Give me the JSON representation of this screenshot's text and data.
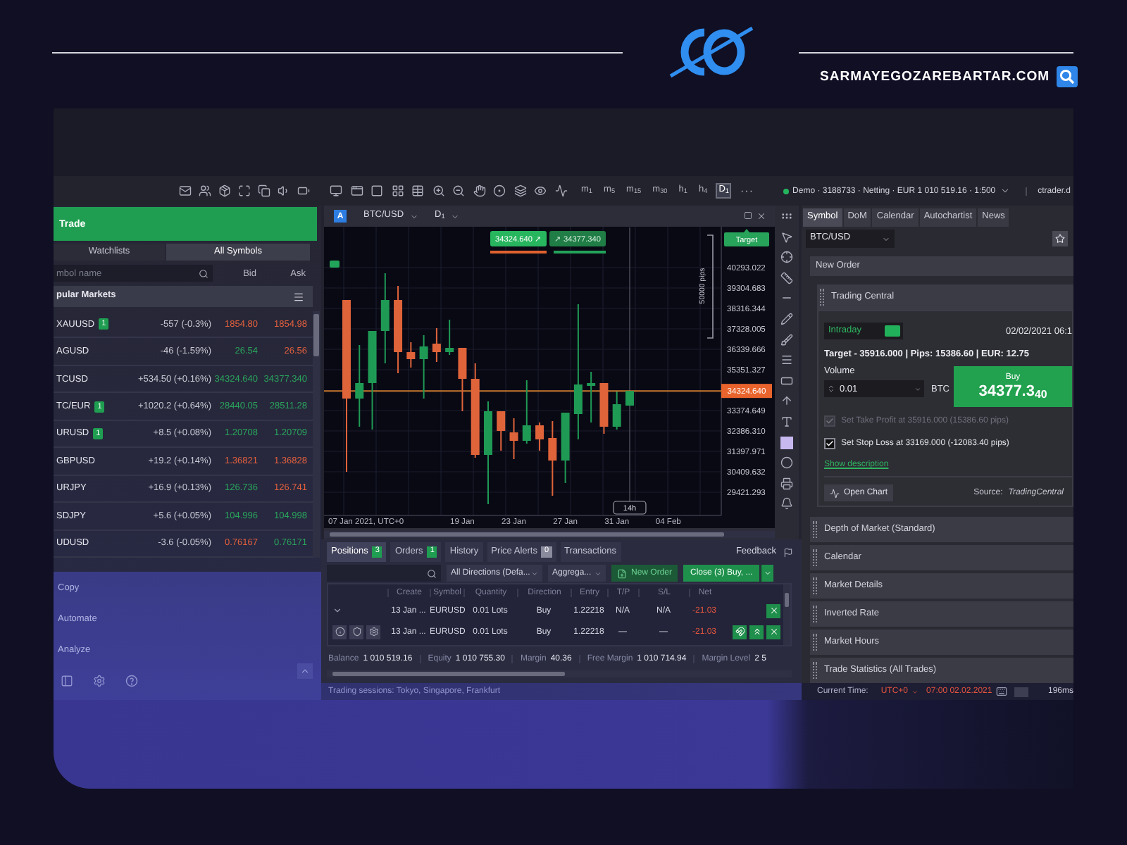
{
  "header": {
    "site_name": "SARMAYEGOZAREBARTAR.COM"
  },
  "toolbar": {
    "timeframes": [
      {
        "label": "m$_{1}$",
        "selected": false
      },
      {
        "label": "m$_{5}$",
        "selected": false
      },
      {
        "label": "m$_{15}$",
        "selected": false
      },
      {
        "label": "m$_{30}$",
        "selected": false
      },
      {
        "label": "h$_{1}$",
        "selected": false
      },
      {
        "label": "h$_{4}$",
        "selected": false
      },
      {
        "label": "D$_{1}$",
        "selected": true
      }
    ],
    "more": "···",
    "connected": true,
    "account": "Demo · 3188733 · Netting · EUR 1 010 519.16 · 1:500",
    "server": "ctrader.d"
  },
  "left_panel": {
    "trade": "Trade",
    "tabs": [
      {
        "label": "Watchlists",
        "selected": false
      },
      {
        "label": "All Symbols",
        "selected": true
      }
    ],
    "search": {
      "placeholder": "mbol name"
    },
    "bid_header": "Bid",
    "ask_header": "Ask",
    "group": "pular Markets",
    "rows": [
      {
        "symbol": "XAUUSD",
        "positions": "1",
        "change": "-557 (-0.3%)",
        "bid": "1854.80",
        "bid_up": false,
        "ask": "1854.98",
        "ask_up": false
      },
      {
        "symbol": "AGUSD",
        "change": "-46 (-1.59%)",
        "bid": "26.54",
        "bid_up": true,
        "ask": "26.56",
        "ask_up": false
      },
      {
        "symbol": "TCUSD",
        "change": "+534.50 (+0.16%)",
        "bid": "34324.640",
        "bid_up": true,
        "ask": "34377.340",
        "ask_up": true
      },
      {
        "symbol": "TC/EUR",
        "positions": "1",
        "change": "+1020.2 (+0.64%)",
        "bid": "28440.05",
        "bid_up": true,
        "ask": "28511.28",
        "ask_up": true
      },
      {
        "symbol": "URUSD",
        "positions": "1",
        "change": "+8.5 (+0.08%)",
        "bid": "1.20708",
        "bid_up": true,
        "ask": "1.20709",
        "ask_up": true
      },
      {
        "symbol": "GBPUSD",
        "change": "+19.2 (+0.14%)",
        "bid": "1.36821",
        "bid_up": false,
        "ask": "1.36828",
        "ask_up": false
      },
      {
        "symbol": "URJPY",
        "change": "+16.9 (+0.13%)",
        "bid": "126.736",
        "bid_up": true,
        "ask": "126.741",
        "ask_up": false
      },
      {
        "symbol": "SDJPY",
        "change": "+5.6 (+0.05%)",
        "bid": "104.996",
        "bid_up": true,
        "ask": "104.998",
        "ask_up": true
      },
      {
        "symbol": "UDUSD",
        "change": "-3.6 (-0.05%)",
        "bid": "0.76167",
        "bid_up": false,
        "ask": "0.76171",
        "ask_up": true
      }
    ],
    "menu": [
      "Copy",
      "Automate",
      "Analyze"
    ]
  },
  "chart": {
    "badge": "A",
    "symbol": "BTC/USD",
    "timeframe": "D$_{1}$",
    "bid": "34324.640 ↗",
    "ask": "↗ 34377.340",
    "target": "Target",
    "range": "50000 pips",
    "start_label": "07 Jan 2021, UTC+0",
    "chart_data": {
      "type": "candlestick",
      "x": [
        "2021-01-10",
        "2021-01-11",
        "2021-01-12",
        "2021-01-13",
        "2021-01-14",
        "2021-01-15",
        "2021-01-16",
        "2021-01-17",
        "2021-01-18",
        "2021-01-19",
        "2021-01-20",
        "2021-01-21",
        "2021-01-22",
        "2021-01-23",
        "2021-01-24",
        "2021-01-25",
        "2021-01-26",
        "2021-01-27",
        "2021-01-28",
        "2021-01-29",
        "2021-01-30",
        "2021-01-31",
        "2021-02-01"
      ],
      "ohlc": [
        [
          38725,
          38725,
          30410,
          33954
        ],
        [
          33954,
          36544,
          32591,
          34704
        ],
        [
          34704,
          37226,
          32455,
          37226
        ],
        [
          37226,
          40020,
          35658,
          38725
        ],
        [
          38725,
          39407,
          35181,
          36203
        ],
        [
          36203,
          36681,
          35454,
          35863
        ],
        [
          35863,
          37021,
          33954,
          36476
        ],
        [
          36612,
          37362,
          35726,
          36203
        ],
        [
          36203,
          37771,
          36067,
          36408
        ],
        [
          36408,
          36408,
          33341,
          34908
        ],
        [
          34908,
          35658,
          31091,
          31228
        ],
        [
          31228,
          33818,
          28842,
          33341
        ],
        [
          33341,
          33341,
          31432,
          32386
        ],
        [
          32318,
          33000,
          31023,
          31909
        ],
        [
          31909,
          34840,
          31773,
          32659
        ],
        [
          32659,
          32795,
          31432,
          31977
        ],
        [
          32046,
          32864,
          29251,
          30955
        ],
        [
          30955,
          33273,
          29865,
          33273
        ],
        [
          33204,
          38521,
          31977,
          34636
        ],
        [
          34568,
          35249,
          32795,
          34704
        ],
        [
          34704,
          34704,
          32250,
          32591
        ],
        [
          32591,
          34295,
          32455,
          33681
        ],
        [
          33613,
          34325,
          33613,
          34324.64
        ]
      ],
      "xlim": [
        "2021-01-08T06:00:00Z",
        "2021-02-08T02:47:00Z"
      ],
      "ylim": [
        28297,
        42270
      ],
      "grid": true,
      "yticks": [
        {
          "value": 40293.022,
          "label": "40293.022"
        },
        {
          "value": 39304.683,
          "label": "39304.683"
        },
        {
          "value": 38316.344,
          "label": "38316.344"
        },
        {
          "value": 37328.005,
          "label": "37328.005"
        },
        {
          "value": 36339.666,
          "label": "36339.666"
        },
        {
          "value": 35351.327,
          "label": "35351.327"
        },
        {
          "value": 33374.649,
          "label": "33374.649"
        },
        {
          "value": 32386.31,
          "label": "32386.310"
        },
        {
          "value": 31397.971,
          "label": "31397.971"
        },
        {
          "value": 30409.632,
          "label": "30409.632"
        },
        {
          "value": 29421.293,
          "label": "29421.293"
        }
      ],
      "xticks": [
        {
          "value": "2021-01-19",
          "label": "19 Jan"
        },
        {
          "value": "2021-01-23",
          "label": "23 Jan"
        },
        {
          "value": "2021-01-27",
          "label": "27 Jan"
        },
        {
          "value": "2021-01-31",
          "label": "31 Jan"
        },
        {
          "value": "2021-02-04",
          "label": "04 Feb"
        }
      ],
      "ref_lines": [
        {
          "axis": "y",
          "value": 34324.64,
          "label": "34324.640"
        },
        {
          "axis": "x",
          "value": "2021-02-01",
          "label": "14h"
        }
      ]
    }
  },
  "positions": {
    "tabs": [
      {
        "label": "Positions",
        "count": "3",
        "badge_active": true,
        "selected": true
      },
      {
        "label": "Orders",
        "count": "1",
        "badge_active": true,
        "selected": false
      },
      {
        "label": "History",
        "selected": false
      },
      {
        "label": "Price Alerts",
        "count": "0",
        "badge_active": false,
        "selected": false
      },
      {
        "label": "Transactions",
        "selected": false
      }
    ],
    "feedback": "Feedback",
    "direction_filter": "All Directions (Defa...",
    "aggregation_filter": "Aggrega...",
    "new_order": "New Order",
    "close_button": "Close (3) Buy, ...",
    "columns": [
      "Create",
      "Symbol",
      "Quantity",
      "Direction",
      "Entry",
      "T/P",
      "S/L",
      "Net"
    ],
    "rows": [
      {
        "kind": "group",
        "expanded": true,
        "cells": [
          "13 Jan ...",
          "EURUSD",
          "0.01 Lots",
          "Buy",
          "1.22218",
          "N/A",
          "N/A",
          "-21.03"
        ]
      },
      {
        "kind": "position",
        "cells": [
          "13 Jan ...",
          "EURUSD",
          "0.01 Lots",
          "Buy",
          "1.22218",
          "—",
          "—",
          "-21.03"
        ]
      }
    ],
    "summary": [
      {
        "label": "Balance",
        "value": "1 010 519.16"
      },
      {
        "label": "Equity",
        "value": "1 010 755.30"
      },
      {
        "label": "Margin",
        "value": "40.36"
      },
      {
        "label": "Free Margin",
        "value": "1 010 714.94"
      },
      {
        "label": "Margin Level",
        "value": "2 5"
      }
    ]
  },
  "right_panel": {
    "tabs": [
      {
        "label": "Symbol",
        "selected": true
      },
      {
        "label": "DoM",
        "selected": false
      },
      {
        "label": "Calendar",
        "selected": false
      },
      {
        "label": "Autochartist",
        "selected": false
      },
      {
        "label": "News",
        "selected": false
      }
    ],
    "symbol": "BTC/USD",
    "sections": [
      {
        "title": "New Order",
        "kind": "header",
        "expanded": false
      },
      {
        "title": "Trading Central",
        "kind": "signal",
        "expanded": true
      },
      {
        "title": "Depth of Market (Standard)",
        "kind": "item",
        "expanded": false
      },
      {
        "title": "Calendar",
        "kind": "item",
        "expanded": false
      },
      {
        "title": "Market Details",
        "kind": "item",
        "expanded": false
      },
      {
        "title": "Inverted Rate",
        "kind": "item",
        "expanded": false
      },
      {
        "title": "Market Hours",
        "kind": "item",
        "expanded": false
      },
      {
        "title": "Trade Statistics (All Trades)",
        "kind": "item",
        "expanded": false
      }
    ],
    "signal": {
      "horizon": "Intraday",
      "active": true,
      "date": "02/02/2021 06:1",
      "target": "Target - 35916.000 | Pips: 15386.60 | EUR: 12.75",
      "volume_label": "Volume",
      "volume": "0.01",
      "unit": "BTC",
      "buy_label": "Buy",
      "buy_price": "34377.3$_{40}$",
      "options": [
        {
          "label": "Set Take Profit at 35916.000 (15386.60 pips)",
          "checked": true,
          "disabled": true
        },
        {
          "label": "Set Stop Loss at 33169.000 (-12083.40 pips)",
          "checked": true,
          "disabled": false
        }
      ],
      "link": "Show description",
      "open_chart": "Open Chart",
      "source_label": "Source:",
      "source": "TradingCentral"
    }
  },
  "status": {
    "sessions": "Trading sessions: Tokyo, Singapore, Frankfurt",
    "time_label": "Current Time:",
    "timezone": "UTC+0",
    "time": "07:00 02.02.2021",
    "latency": "196ms"
  }
}
